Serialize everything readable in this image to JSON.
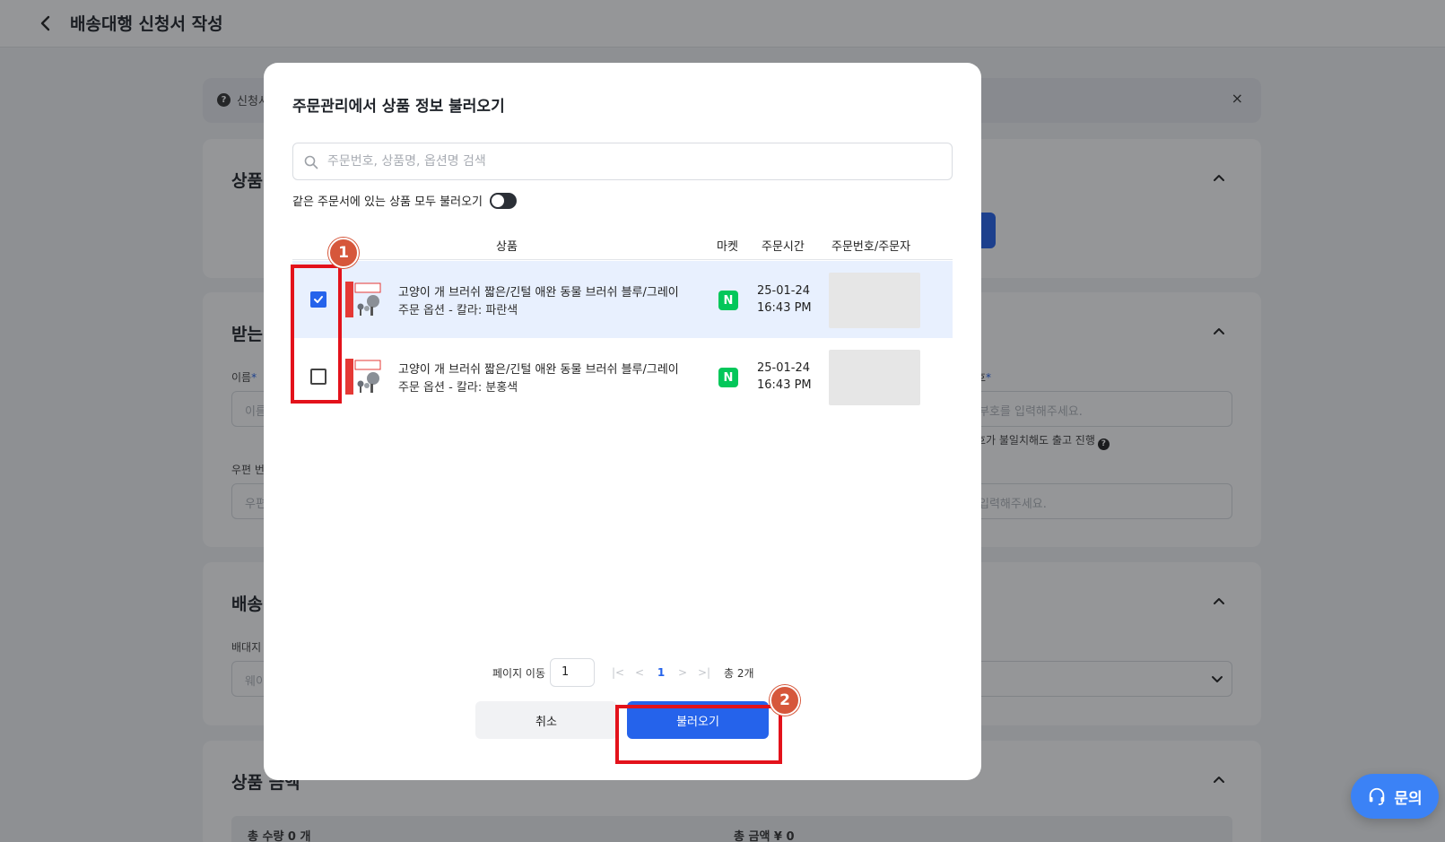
{
  "page": {
    "title": "배송대행 신청서 작성",
    "notice_text": "신청서",
    "notice_close": "×",
    "sections": {
      "product": "상품",
      "recipient": "받는",
      "shipping": "배송",
      "product_amount": "상품 금액"
    },
    "fields": {
      "name_label": "이름",
      "name_placeholder": "이름",
      "postcode_label": "우편 번",
      "postcode_placeholder": "우편",
      "customs_label": "호",
      "customs_placeholder": "부호를 입력해주세요.",
      "customs_hint": "호가 불일치해도 출고 진행",
      "address_placeholder": "입력해주세요.",
      "ship_label": "배대지",
      "ship_placeholder": "웨이"
    },
    "summary": {
      "total_qty": "총 수량 0 개",
      "total_amount": "총 금액 ¥ 0"
    },
    "inquiry_label": "문의"
  },
  "modal": {
    "title": "주문관리에서 상품 정보 불러오기",
    "search_placeholder": "주문번호, 상품명, 옵션명 검색",
    "toggle_label": "같은 주문서에 있는 상품 모두 불러오기",
    "columns": {
      "product": "상품",
      "market": "마켓",
      "order_time": "주문시간",
      "order_no": "주문번호/주문자"
    },
    "rows": [
      {
        "checked": true,
        "name": "고양이 개 브러쉬 짧은/긴털 애완 동물 브러쉬 블루/그레이",
        "option": "주문 옵션 - 칼라: 파란색",
        "market_icon": "N",
        "date": "25-01-24",
        "time": "16:43 PM"
      },
      {
        "checked": false,
        "name": "고양이 개 브러쉬 짧은/긴털 애완 동물 브러쉬 블루/그레이",
        "option": "주문 옵션 - 칼라: 분홍색",
        "market_icon": "N",
        "date": "25-01-24",
        "time": "16:43 PM"
      }
    ],
    "pagination": {
      "label": "페이지 이동",
      "current_input": "1",
      "current_page": "1",
      "total": "총 2개"
    },
    "buttons": {
      "cancel": "취소",
      "load": "불러오기"
    }
  },
  "annotations": {
    "marker_1": "1",
    "marker_2": "2",
    "highlight_color": "#e3121b",
    "marker_color": "#d6573b"
  },
  "colors": {
    "accent": "#2563eb",
    "naver_green": "#03c75a"
  }
}
